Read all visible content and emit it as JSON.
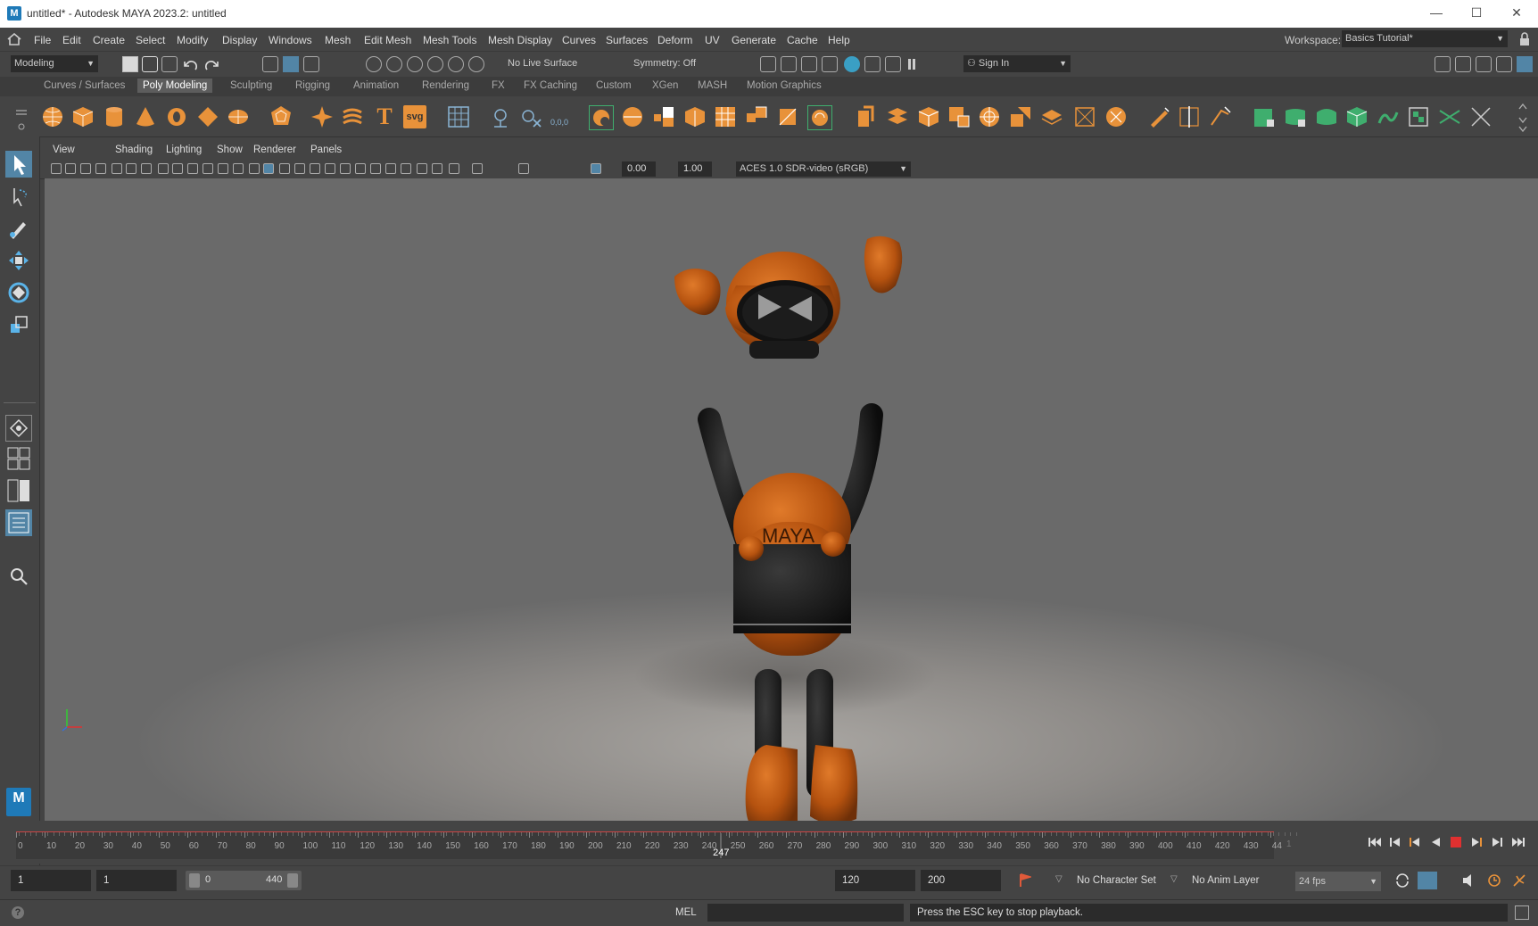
{
  "window": {
    "title": "untitled* - Autodesk MAYA 2023.2: untitled",
    "logo_letter": "M",
    "minimize": "—",
    "maximize": "☐",
    "close": "✕"
  },
  "menubar": {
    "items": [
      "File",
      "Edit",
      "Create",
      "Select",
      "Modify",
      "Display",
      "Windows",
      "Mesh",
      "Edit Mesh",
      "Mesh Tools",
      "Mesh Display",
      "Curves",
      "Surfaces",
      "Deform",
      "UV",
      "Generate",
      "Cache",
      "Help"
    ],
    "workspace_label": "Workspace:",
    "workspace_value": "Basics Tutorial*"
  },
  "statusline": {
    "menuset": "Modeling",
    "live_surface": "No Live Surface",
    "symmetry": "Symmetry: Off",
    "sign_in": "Sign In"
  },
  "shelf": {
    "tabs": [
      "Curves / Surfaces",
      "Poly Modeling",
      "Sculpting",
      "Rigging",
      "Animation",
      "Rendering",
      "FX",
      "FX Caching",
      "Custom",
      "XGen",
      "MASH",
      "Motion Graphics"
    ],
    "active_tab": "Poly Modeling",
    "text_icon": "T",
    "svg_icon": "svg",
    "coord_icon": "0,0,0"
  },
  "panel": {
    "menus": [
      "View",
      "Shading",
      "Lighting",
      "Show",
      "Renderer",
      "Panels"
    ],
    "exposure": "0.00",
    "gamma": "1.00",
    "color_space": "ACES 1.0 SDR-video (sRGB)"
  },
  "viewport": {
    "robot_chest_text": "MAYA",
    "axis_x_color": "#d33",
    "axis_y_color": "#3c3"
  },
  "timeline": {
    "ticks": [
      "0",
      "10",
      "20",
      "30",
      "40",
      "50",
      "60",
      "70",
      "80",
      "90",
      "100",
      "110",
      "120",
      "130",
      "140",
      "150",
      "160",
      "170",
      "180",
      "190",
      "200",
      "210",
      "220",
      "230",
      "240",
      "250",
      "260",
      "270",
      "280",
      "290",
      "300",
      "310",
      "320",
      "330",
      "340",
      "350",
      "360",
      "370",
      "380",
      "390",
      "400",
      "410",
      "420",
      "430",
      "44"
    ],
    "current_frame": "247",
    "end_marker": "1",
    "current_frame_value": 247,
    "max_frame": 440
  },
  "range": {
    "start_frame": "1",
    "playback_start": "1",
    "slider_start": "0",
    "slider_end": "440",
    "playback_end": "120",
    "anim_end": "200",
    "character_set": "No Character Set",
    "anim_layer": "No Anim Layer",
    "fps": "24 fps"
  },
  "commandline": {
    "help": "?",
    "language": "MEL",
    "message": "Press the ESC key to stop playback."
  },
  "colors": {
    "accent": "#5285a6",
    "shelf_orange": "#e8923a",
    "shelf_green": "#3fae6e",
    "timeline_red": "#c44",
    "robot_orange": "#c35e12"
  }
}
